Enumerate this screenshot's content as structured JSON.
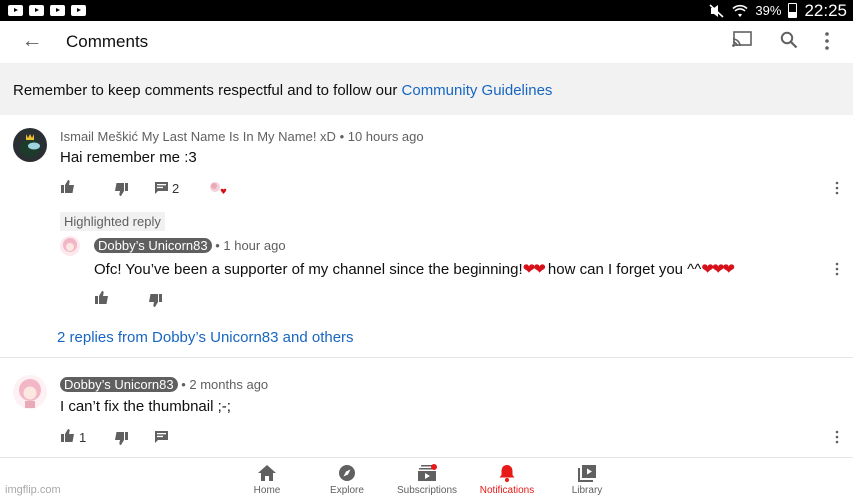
{
  "status_bar": {
    "battery": "39%",
    "time": "22:25"
  },
  "app_bar": {
    "title": "Comments"
  },
  "banner": {
    "text": "Remember to keep comments respectful and to follow our ",
    "link": "Community Guidelines"
  },
  "comments": [
    {
      "author": "Ismail Meškić My Last Name Is In My Name! xD",
      "age": " • 10 hours ago",
      "text": "Hai remember me :3",
      "reply_count": "2"
    },
    {
      "author": "Dobby’s Unicorn83",
      "age": " • 2 months ago",
      "text": "I can’t fix the thumbnail ;-;",
      "like_count": "1"
    }
  ],
  "highlighted_reply": {
    "tag": "Highlighted reply",
    "author": "Dobby’s Unicorn83",
    "age": " • 1 hour ago",
    "text_a": "Ofc! You’ve been a supporter of my channel since the beginning!",
    "hearts_a": "❤❤",
    "text_b": " how can I forget you ^^",
    "hearts_b": "❤❤❤"
  },
  "replies_link": "2 replies from Dobby’s Unicorn83 and others",
  "bottom_nav": [
    {
      "label": "Home",
      "icon": "home-icon"
    },
    {
      "label": "Explore",
      "icon": "explore-icon"
    },
    {
      "label": "Subscriptions",
      "icon": "subscriptions-icon"
    },
    {
      "label": "Notifications",
      "icon": "bell-icon",
      "active": true
    },
    {
      "label": "Library",
      "icon": "library-icon"
    }
  ],
  "watermark": "imgflip.com",
  "colors": {
    "link": "#1766c2",
    "accent_red": "#e81919",
    "banner_bg": "#f2f2f2"
  }
}
